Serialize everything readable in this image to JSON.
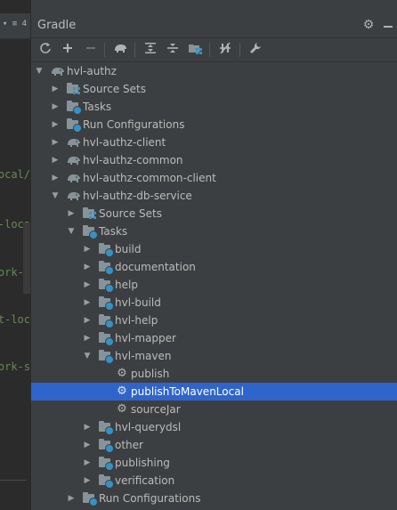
{
  "editor": {
    "tab_label": "▾ ≡ 4",
    "code_lines": [
      "ocal/",
      "-loca",
      "ork-r",
      "t-loc",
      "ork-s"
    ]
  },
  "panel": {
    "title": "Gradle",
    "settings_icon": "gear-icon",
    "hide_icon": "minimize-icon"
  },
  "toolbar": [
    {
      "name": "refresh-button",
      "icon": "refresh-icon",
      "glyph": "⟳"
    },
    {
      "name": "add-button",
      "icon": "plus-icon",
      "glyph": "+"
    },
    {
      "name": "remove-button",
      "icon": "minus-icon",
      "glyph": "−"
    },
    {
      "name": "execute-task-button",
      "icon": "gradle-elephant-icon",
      "glyph": "🐘"
    },
    {
      "name": "expand-all-button",
      "icon": "expand-all-icon",
      "glyph": "⇕"
    },
    {
      "name": "collapse-all-button",
      "icon": "collapse-all-icon",
      "glyph": "⇳"
    },
    {
      "name": "group-modules-button",
      "icon": "folder-grid-icon",
      "glyph": "▦"
    },
    {
      "name": "offline-mode-button",
      "icon": "toggle-offline-icon",
      "glyph": "⇹"
    },
    {
      "name": "gradle-settings-button",
      "icon": "wrench-icon",
      "glyph": "🔧"
    }
  ],
  "tree": [
    {
      "label": "hvl-authz",
      "level": 0,
      "arrow": "down",
      "icon": "elephant"
    },
    {
      "label": "Source Sets",
      "level": 1,
      "arrow": "right",
      "icon": "folder-grid"
    },
    {
      "label": "Tasks",
      "level": 1,
      "arrow": "right",
      "icon": "folder-gear"
    },
    {
      "label": "Run Configurations",
      "level": 1,
      "arrow": "right",
      "icon": "folder-gear"
    },
    {
      "label": "hvl-authz-client",
      "level": 1,
      "arrow": "right",
      "icon": "elephant"
    },
    {
      "label": "hvl-authz-common",
      "level": 1,
      "arrow": "right",
      "icon": "elephant"
    },
    {
      "label": "hvl-authz-common-client",
      "level": 1,
      "arrow": "right",
      "icon": "elephant"
    },
    {
      "label": "hvl-authz-db-service",
      "level": 1,
      "arrow": "down",
      "icon": "elephant"
    },
    {
      "label": "Source Sets",
      "level": 2,
      "arrow": "right",
      "icon": "folder-grid"
    },
    {
      "label": "Tasks",
      "level": 2,
      "arrow": "down",
      "icon": "folder-gear"
    },
    {
      "label": "build",
      "level": 3,
      "arrow": "right",
      "icon": "folder-gear"
    },
    {
      "label": "documentation",
      "level": 3,
      "arrow": "right",
      "icon": "folder-gear"
    },
    {
      "label": "help",
      "level": 3,
      "arrow": "right",
      "icon": "folder-gear"
    },
    {
      "label": "hvl-build",
      "level": 3,
      "arrow": "right",
      "icon": "folder-gear"
    },
    {
      "label": "hvl-help",
      "level": 3,
      "arrow": "right",
      "icon": "folder-gear"
    },
    {
      "label": "hvl-mapper",
      "level": 3,
      "arrow": "right",
      "icon": "folder-gear"
    },
    {
      "label": "hvl-maven",
      "level": 3,
      "arrow": "down",
      "icon": "folder-gear"
    },
    {
      "label": "publish",
      "level": 4,
      "arrow": "none",
      "icon": "gear"
    },
    {
      "label": "publishToMavenLocal",
      "level": 4,
      "arrow": "none",
      "icon": "gear",
      "selected": true
    },
    {
      "label": "sourceJar",
      "level": 4,
      "arrow": "none",
      "icon": "gear"
    },
    {
      "label": "hvl-querydsl",
      "level": 3,
      "arrow": "right",
      "icon": "folder-gear"
    },
    {
      "label": "other",
      "level": 3,
      "arrow": "right",
      "icon": "folder-gear"
    },
    {
      "label": "publishing",
      "level": 3,
      "arrow": "right",
      "icon": "folder-gear"
    },
    {
      "label": "verification",
      "level": 3,
      "arrow": "right",
      "icon": "folder-gear"
    },
    {
      "label": "Run Configurations",
      "level": 2,
      "arrow": "right",
      "icon": "folder-gear"
    }
  ],
  "colors": {
    "selection": "#2f65ca",
    "panel_bg": "#3c3f41",
    "editor_bg": "#2b2b2b",
    "badge_blue": "#3592c4"
  }
}
